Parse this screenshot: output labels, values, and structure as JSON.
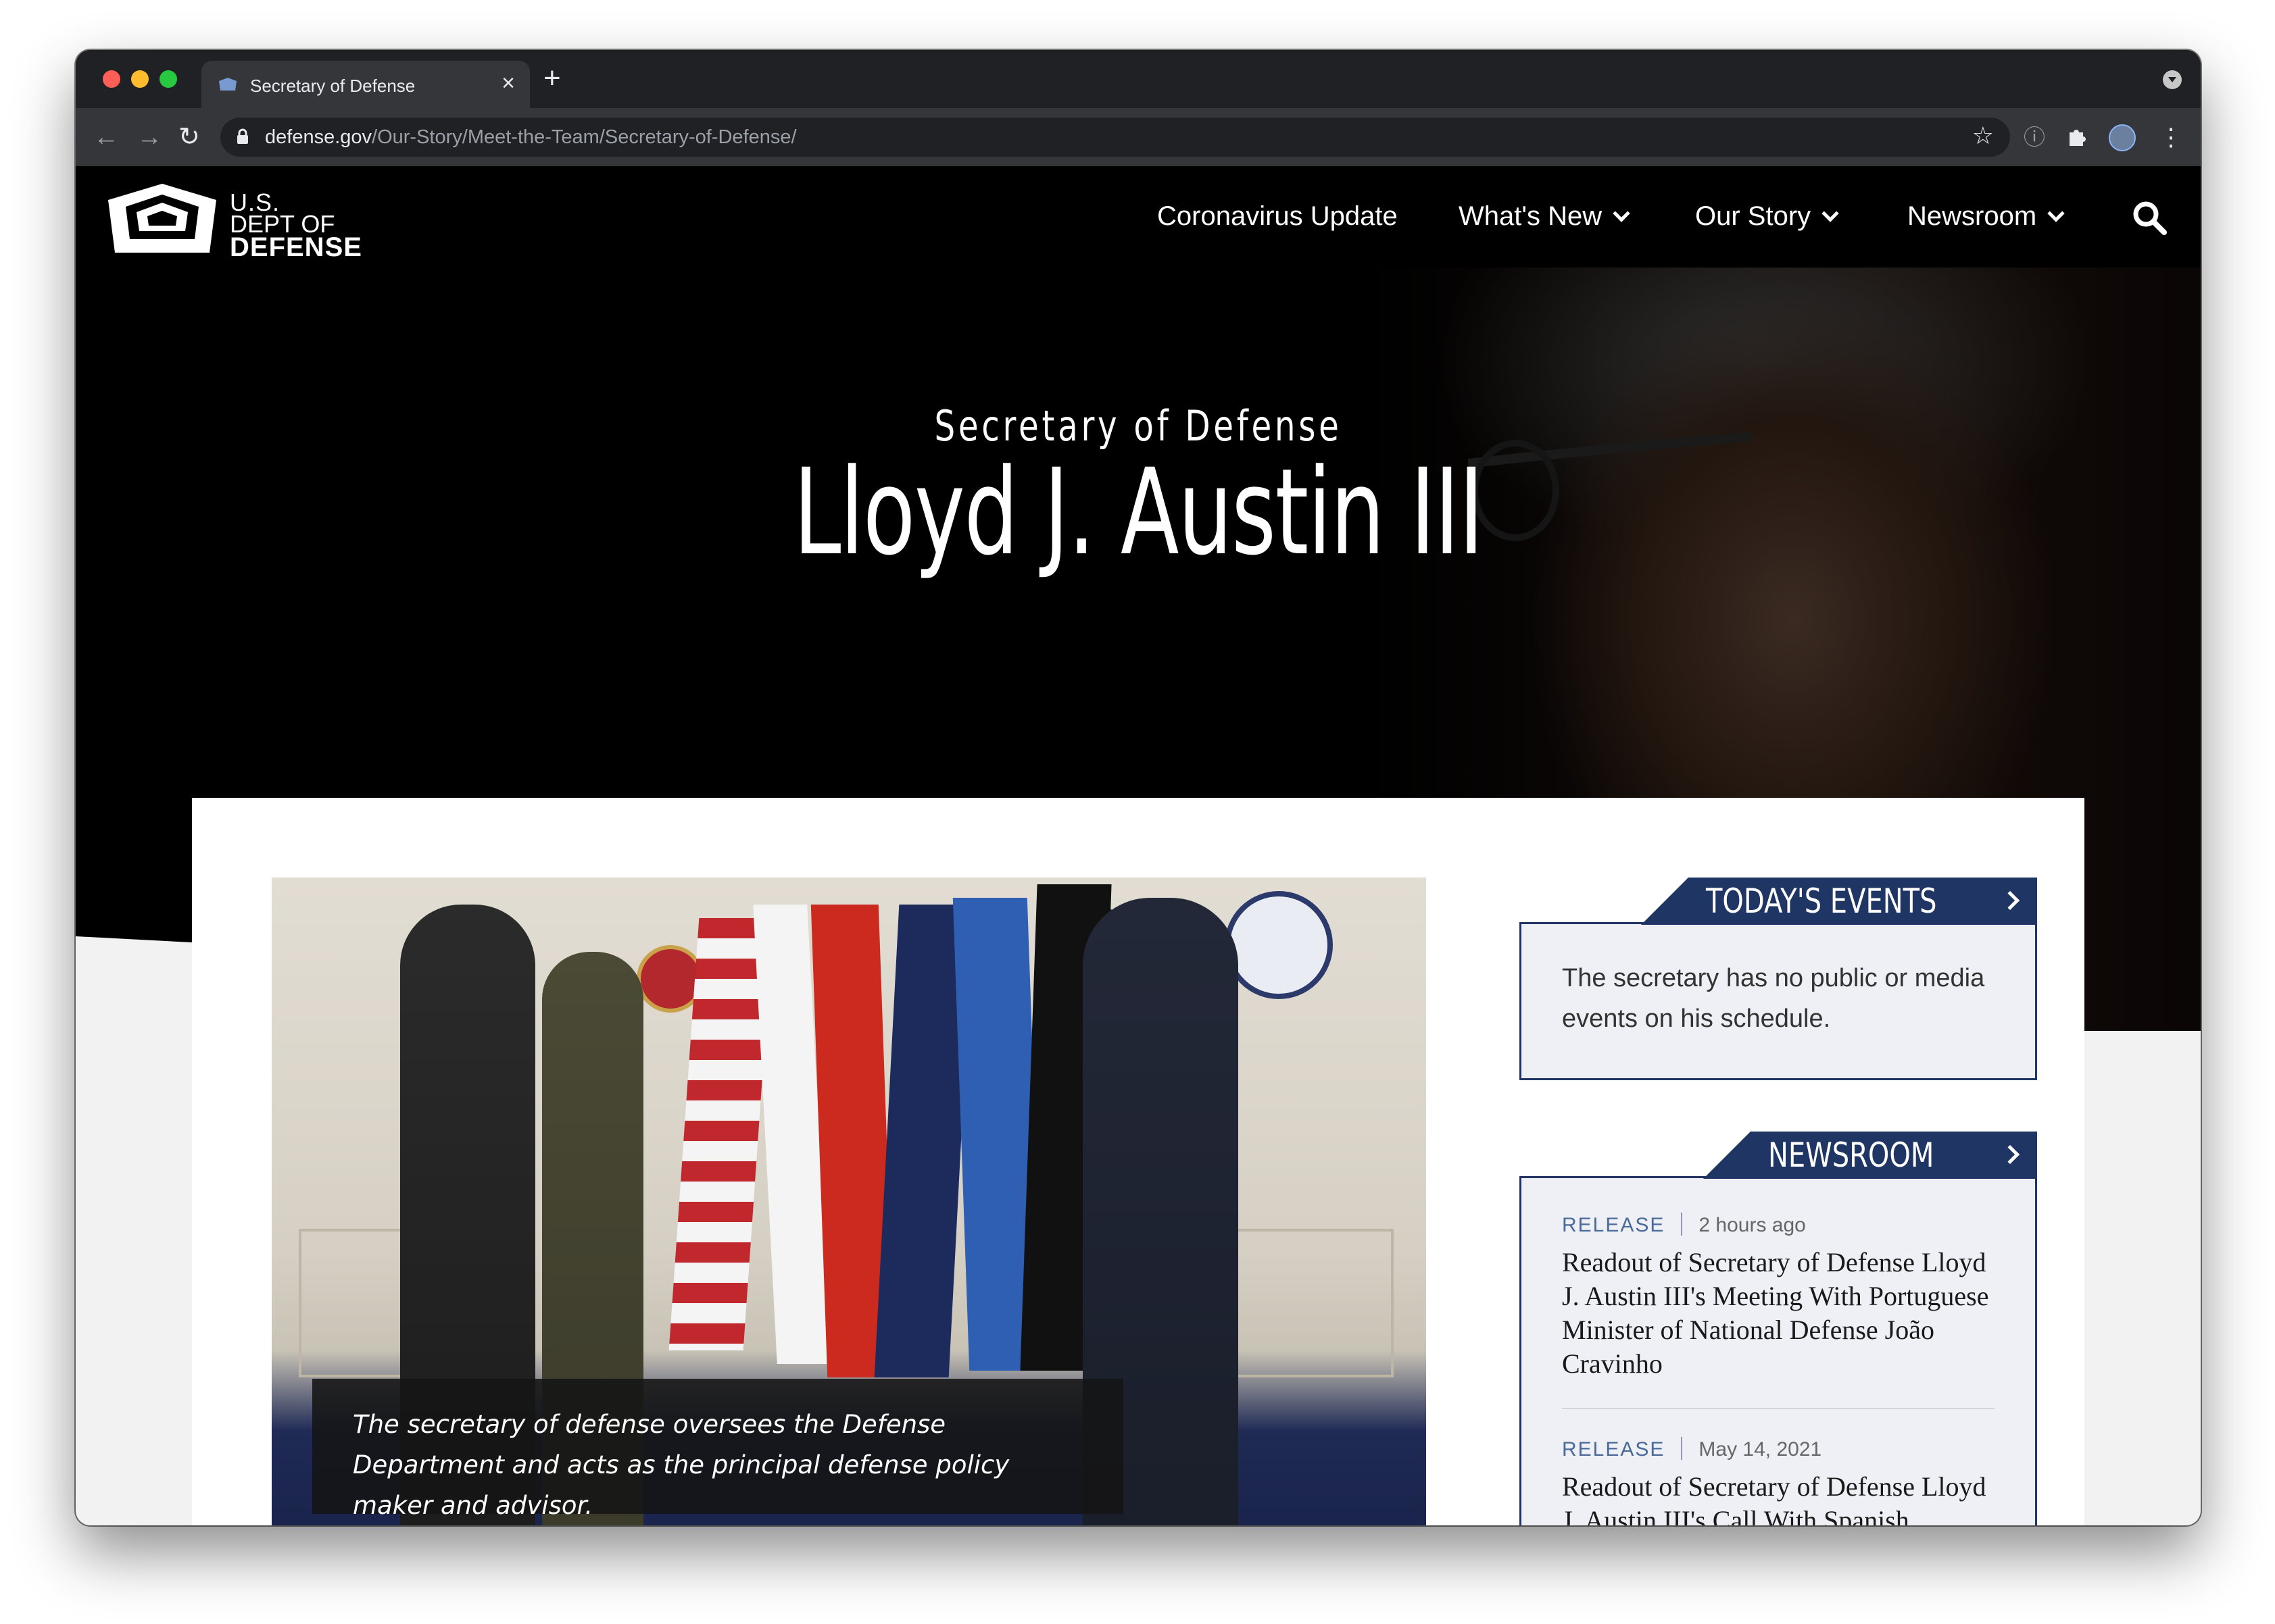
{
  "browser": {
    "tab_title": "Secretary of Defense",
    "new_tab_label": "+",
    "url_host": "defense.gov",
    "url_path": "/Our-Story/Meet-the-Team/Secretary-of-Defense/"
  },
  "site": {
    "logo": {
      "line1": "U.S.",
      "line2": "DEPT OF",
      "line3": "DEFENSE"
    },
    "nav": [
      {
        "label": "Coronavirus Update",
        "has_dropdown": false
      },
      {
        "label": "What's New",
        "has_dropdown": true
      },
      {
        "label": "Our Story",
        "has_dropdown": true
      },
      {
        "label": "Newsroom",
        "has_dropdown": true
      }
    ]
  },
  "hero": {
    "subtitle": "Secretary of Defense",
    "name": "Lloyd J. Austin III"
  },
  "main": {
    "caption": "The secretary of defense oversees the Defense Department and acts as the principal defense policy maker and advisor."
  },
  "todays_events": {
    "title": "TODAY'S EVENTS",
    "text": "The secretary has no public or media events on his schedule."
  },
  "newsroom": {
    "title": "NEWSROOM",
    "items": [
      {
        "type": "RELEASE",
        "date": "2 hours ago",
        "title": "Readout of Secretary of Defense Lloyd J. Austin III's Meeting With Portuguese Minister of National Defense João Cravinho"
      },
      {
        "type": "RELEASE",
        "date": "May 14, 2021",
        "title": "Readout of Secretary of Defense Lloyd J. Austin III's Call With Spanish Minister of Defense Margarita Robles"
      }
    ]
  },
  "colors": {
    "navy": "#1f3564",
    "widget_bg": "#eef0f5",
    "header_bg": "#000000"
  }
}
